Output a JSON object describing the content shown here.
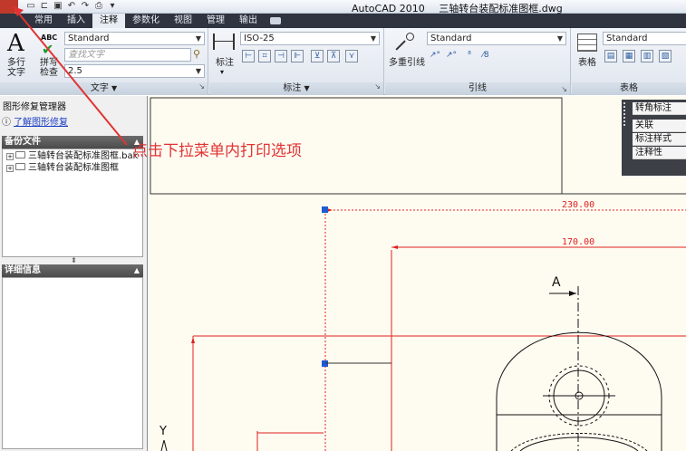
{
  "window": {
    "app_name": "AutoCAD 2010",
    "file_name": "三轴转台装配标准图框.dwg"
  },
  "ribbon_tabs": [
    "常用",
    "插入",
    "注释",
    "参数化",
    "视图",
    "管理",
    "输出"
  ],
  "active_tab": "注释",
  "panels": {
    "text": {
      "title": "文字",
      "mtext_label_1": "多行",
      "mtext_label_2": "文字",
      "check_label_1": "拼写",
      "check_label_2": "检查",
      "abc_label": "ABC",
      "style_value": "Standard",
      "find_placeholder": "查找文字",
      "height_value": "2.5"
    },
    "dimension": {
      "title": "标注",
      "dim_label": "标注",
      "style_value": "ISO-25"
    },
    "leader": {
      "title": "引线",
      "multileader_label": "多重引线",
      "style_value": "Standard"
    },
    "table": {
      "title": "表格",
      "table_label": "表格",
      "style_value": "Standard"
    }
  },
  "palette": {
    "title": "图形修复管理器",
    "help_link": "了解图形修复",
    "backup_header": "备份文件",
    "backup_files": [
      "三轴转台装配标准图框.bak",
      "三轴转台装配标准图框"
    ],
    "details_header": "详细信息"
  },
  "annotation": {
    "instruction": "点击下拉菜单内打印选项",
    "color": "#e03434"
  },
  "float_toolbar": {
    "items": [
      "转角标注",
      "关联",
      "标注样式",
      "注释性"
    ]
  },
  "drawing": {
    "dim_top": "230.00",
    "dim_second": "170.00",
    "section_label": "A",
    "axis_label": "Y"
  },
  "colors": {
    "ribbon_dark": "#2f3440",
    "canvas_bg": "#fefcf1",
    "dim_red": "#e02020",
    "grip_blue": "#1f5bd0"
  }
}
